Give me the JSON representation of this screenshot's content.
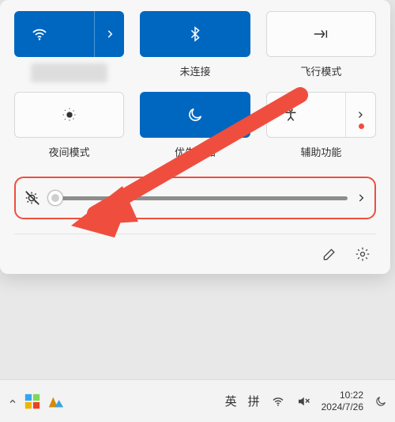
{
  "tiles": {
    "wifi": {
      "label": "",
      "active": true,
      "split": true
    },
    "bluetooth": {
      "label": "未连接",
      "active": true,
      "split": false
    },
    "airplane": {
      "label": "飞行模式",
      "active": false,
      "split": false
    },
    "nightlight": {
      "label": "夜间模式",
      "active": false,
      "split": false
    },
    "dnd": {
      "label": "优先通知",
      "active": true,
      "split": false
    },
    "accessibility": {
      "label": "辅助功能",
      "active": false,
      "split": true
    }
  },
  "slider": {
    "kind": "brightness-muted",
    "value_percent": 2,
    "expand_label": "展开"
  },
  "footer": {
    "edit_label": "编辑",
    "settings_label": "设置"
  },
  "taskbar": {
    "ime1": "英",
    "ime2": "拼",
    "time": "10:22",
    "date": "2024/7/26"
  },
  "annotation": {
    "color": "#ef4e3e"
  }
}
